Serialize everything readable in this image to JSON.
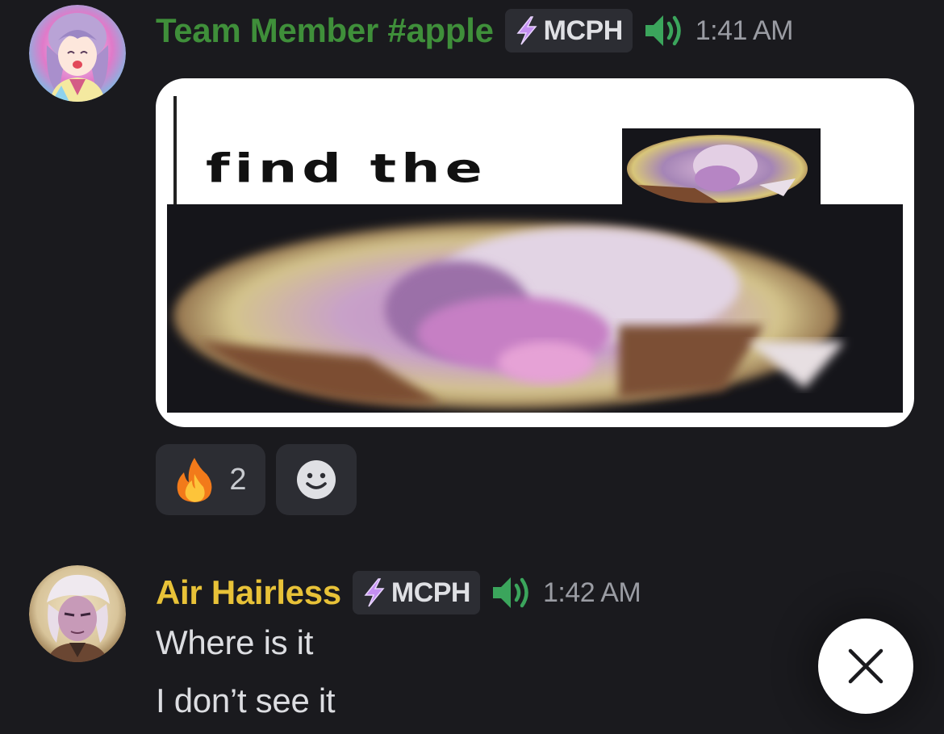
{
  "messages": [
    {
      "author": "Team Member #apple",
      "author_color": "#3f8f3a",
      "tag": "MCPH",
      "tag_icon": "lightning-bolt-icon",
      "voice_icon": "speaker-icon",
      "timestamp": "1:41 AM",
      "embed": {
        "caption_text": "find the",
        "image_type": "meme-image"
      },
      "reactions": [
        {
          "emoji": "fire-emoji",
          "count": "2"
        }
      ],
      "add_reaction_icon": "smiley-icon"
    },
    {
      "author": "Air Hairless",
      "author_color": "#e8c238",
      "tag": "MCPH",
      "tag_icon": "lightning-bolt-icon",
      "voice_icon": "speaker-icon",
      "timestamp": "1:42 AM",
      "lines": [
        "Where is it",
        "I don’t see it"
      ]
    }
  ],
  "close_button_icon": "close-icon",
  "colors": {
    "background": "#1a1a1e",
    "badge_background": "#2c2d33",
    "speaker_green": "#3ba55c"
  }
}
